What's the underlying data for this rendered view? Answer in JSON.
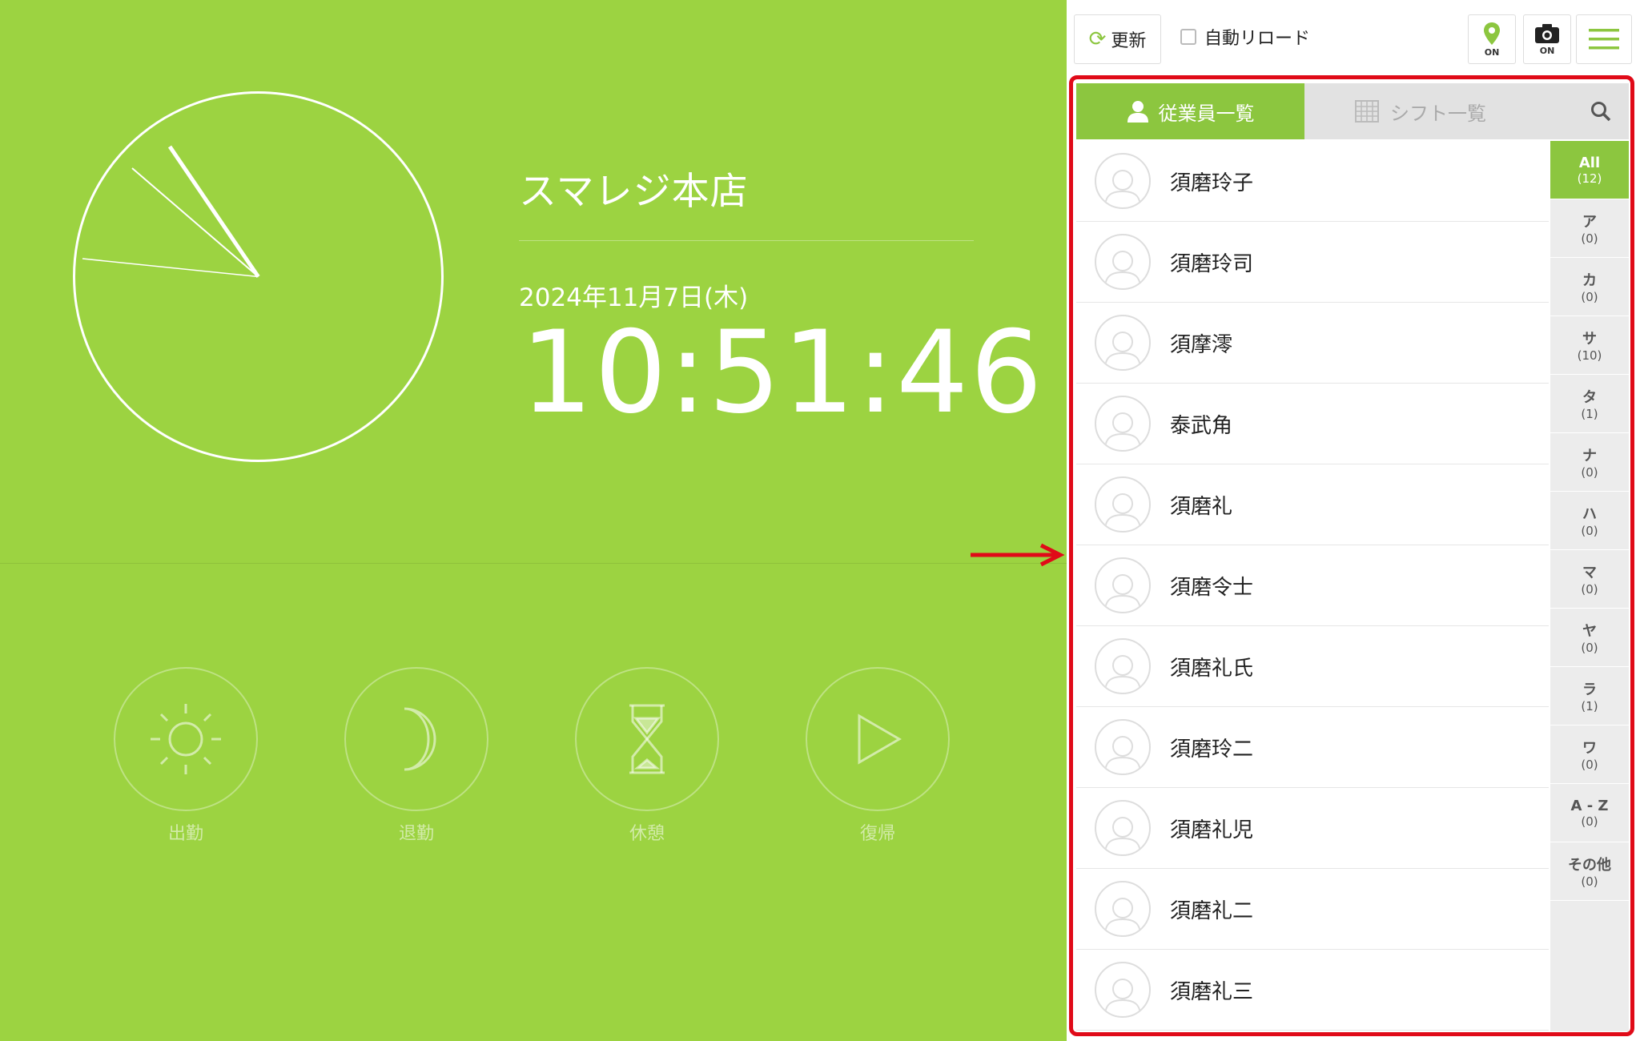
{
  "store_name": "スマレジ本店",
  "date": "2024年11月7日(木)",
  "time": "10:51:46",
  "actions": [
    {
      "label": "出勤",
      "icon": "sun-icon"
    },
    {
      "label": "退勤",
      "icon": "moon-icon"
    },
    {
      "label": "休憩",
      "icon": "hourglass-icon"
    },
    {
      "label": "復帰",
      "icon": "play-icon"
    }
  ],
  "toolbar": {
    "reload_label": "更新",
    "auto_reload_label": "自動リロード",
    "location_status": "ON",
    "camera_status": "ON"
  },
  "tabs": {
    "employees": "従業員一覧",
    "shifts": "シフト一覧"
  },
  "employees": [
    "須磨玲子",
    "須磨玲司",
    "須摩澪",
    "泰武角",
    "須磨礼",
    "須磨令士",
    "須磨礼氏",
    "須磨玲二",
    "須磨礼児",
    "須磨礼二",
    "須磨礼三"
  ],
  "index": [
    {
      "key": "All",
      "count": "(12)"
    },
    {
      "key": "ア",
      "count": "(0)"
    },
    {
      "key": "カ",
      "count": "(0)"
    },
    {
      "key": "サ",
      "count": "(10)"
    },
    {
      "key": "タ",
      "count": "(1)"
    },
    {
      "key": "ナ",
      "count": "(0)"
    },
    {
      "key": "ハ",
      "count": "(0)"
    },
    {
      "key": "マ",
      "count": "(0)"
    },
    {
      "key": "ヤ",
      "count": "(0)"
    },
    {
      "key": "ラ",
      "count": "(1)"
    },
    {
      "key": "ワ",
      "count": "(0)"
    },
    {
      "key": "A - Z",
      "count": "(0)"
    },
    {
      "key": "その他",
      "count": "(0)"
    }
  ],
  "colors": {
    "accent": "#9cd341",
    "tab_active": "#8cc63f",
    "highlight": "#e00a18"
  }
}
